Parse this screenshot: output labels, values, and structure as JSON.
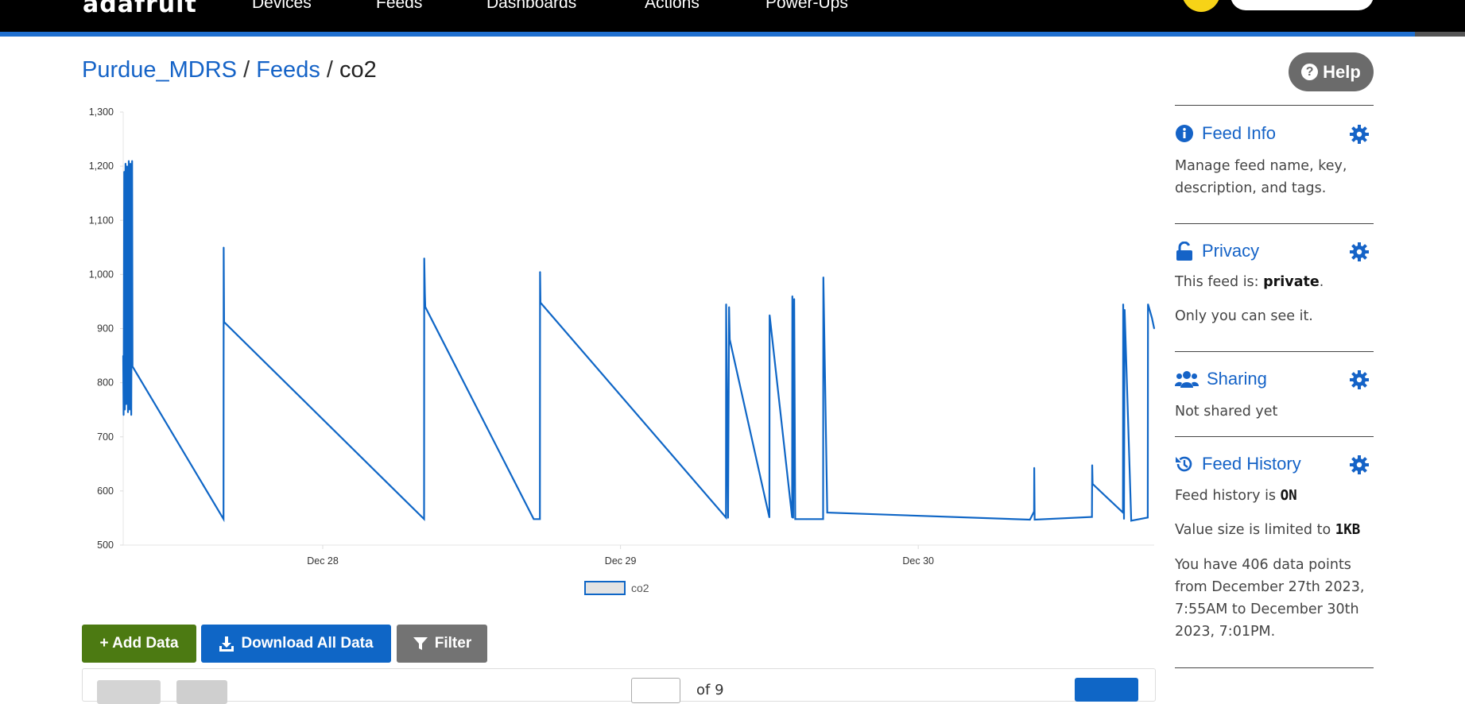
{
  "nav": {
    "brand": "adafruit",
    "items": [
      "Devices",
      "Feeds",
      "Dashboards",
      "Actions",
      "Power-Ups"
    ]
  },
  "breadcrumb": {
    "root": "Purdue_MDRS",
    "feeds": "Feeds",
    "current": "co2",
    "separator": "/"
  },
  "help": {
    "label": "Help"
  },
  "chart_data": {
    "type": "line",
    "series": [
      {
        "name": "co2",
        "color": "#0f66c6",
        "points": [
          [
            "2023-12-27 07:55",
            850
          ],
          [
            "2023-12-27 07:57",
            740
          ],
          [
            "2023-12-27 08:00",
            1190
          ],
          [
            "2023-12-27 08:03",
            750
          ],
          [
            "2023-12-27 08:06",
            1205
          ],
          [
            "2023-12-27 08:10",
            760
          ],
          [
            "2023-12-27 08:14",
            1200
          ],
          [
            "2023-12-27 08:18",
            745
          ],
          [
            "2023-12-27 08:22",
            1210
          ],
          [
            "2023-12-27 08:26",
            750
          ],
          [
            "2023-12-27 08:30",
            1205
          ],
          [
            "2023-12-27 08:34",
            740
          ],
          [
            "2023-12-27 08:38",
            1210
          ],
          [
            "2023-12-27 08:40",
            830
          ],
          [
            "2023-12-27 16:00",
            548
          ],
          [
            "2023-12-27 16:01",
            1050
          ],
          [
            "2023-12-27 16:03",
            912
          ],
          [
            "2023-12-28 08:10",
            548
          ],
          [
            "2023-12-28 08:11",
            1030
          ],
          [
            "2023-12-28 08:14",
            965
          ],
          [
            "2023-12-28 08:16",
            940
          ],
          [
            "2023-12-28 17:00",
            548
          ],
          [
            "2023-12-28 17:30",
            548
          ],
          [
            "2023-12-28 17:31",
            1005
          ],
          [
            "2023-12-28 17:33",
            948
          ],
          [
            "2023-12-29 08:30",
            551
          ],
          [
            "2023-12-29 08:31",
            945
          ],
          [
            "2023-12-29 08:40",
            550
          ],
          [
            "2023-12-29 08:45",
            940
          ],
          [
            "2023-12-29 08:48",
            880
          ],
          [
            "2023-12-29 12:00",
            551
          ],
          [
            "2023-12-29 12:01",
            925
          ],
          [
            "2023-12-29 13:50",
            551
          ],
          [
            "2023-12-29 13:51",
            960
          ],
          [
            "2023-12-29 13:55",
            550
          ],
          [
            "2023-12-29 14:00",
            955
          ],
          [
            "2023-12-29 14:05",
            548
          ],
          [
            "2023-12-29 15:00",
            548
          ],
          [
            "2023-12-29 16:20",
            548
          ],
          [
            "2023-12-29 16:21",
            995
          ],
          [
            "2023-12-29 16:40",
            560
          ],
          [
            "2023-12-30 09:00",
            547
          ],
          [
            "2023-12-30 09:20",
            562
          ],
          [
            "2023-12-30 09:21",
            643
          ],
          [
            "2023-12-30 09:23",
            547
          ],
          [
            "2023-12-30 14:00",
            552
          ],
          [
            "2023-12-30 14:01",
            648
          ],
          [
            "2023-12-30 14:03",
            613
          ],
          [
            "2023-12-30 16:30",
            560
          ],
          [
            "2023-12-30 16:31",
            945
          ],
          [
            "2023-12-30 16:35",
            548
          ],
          [
            "2023-12-30 16:38",
            935
          ],
          [
            "2023-12-30 17:10",
            545
          ],
          [
            "2023-12-30 18:30",
            551
          ],
          [
            "2023-12-30 18:31",
            945
          ],
          [
            "2023-12-30 18:50",
            920
          ],
          [
            "2023-12-30 19:01",
            900
          ]
        ]
      }
    ],
    "x_ticks": [
      "Dec 28",
      "Dec 29",
      "Dec 30"
    ],
    "x_tick_values": [
      "2023-12-28 00:00",
      "2023-12-29 00:00",
      "2023-12-30 00:00"
    ],
    "xlim": [
      "2023-12-27 07:55",
      "2023-12-30 19:01"
    ],
    "ylim": [
      500,
      1300
    ],
    "y_ticks": [
      "500",
      "600",
      "700",
      "800",
      "900",
      "1,000",
      "1,100",
      "1,200",
      "1,300"
    ],
    "y_tick_values": [
      500,
      600,
      700,
      800,
      900,
      1000,
      1100,
      1200,
      1300
    ],
    "legend": [
      "co2"
    ],
    "legend_position": "bottom-center",
    "grid": false
  },
  "actions": {
    "add": "+ Add Data",
    "download": "Download All Data",
    "filter": "Filter"
  },
  "pagination": {
    "of_label": "of 9"
  },
  "sidebar": {
    "feed_info": {
      "title": "Feed Info",
      "description": "Manage feed name, key, description, and tags."
    },
    "privacy": {
      "title": "Privacy",
      "status_prefix": "This feed is: ",
      "status_value": "private",
      "status_suffix": ".",
      "note": "Only you can see it."
    },
    "sharing": {
      "title": "Sharing",
      "status": "Not shared yet"
    },
    "history": {
      "title": "Feed History",
      "status_prefix": "Feed history is ",
      "status_value": "ON",
      "limit_prefix": "Value size is limited to ",
      "limit_value": "1KB",
      "summary": "You have 406 data points from December 27th 2023, 7:55AM to December 30th 2023, 7:01PM."
    }
  },
  "colors": {
    "accent": "#1563c7",
    "add_button": "#4c7a12",
    "download_button": "#0f66c6",
    "filter_button": "#737373",
    "help_button": "#6b6b6b"
  }
}
